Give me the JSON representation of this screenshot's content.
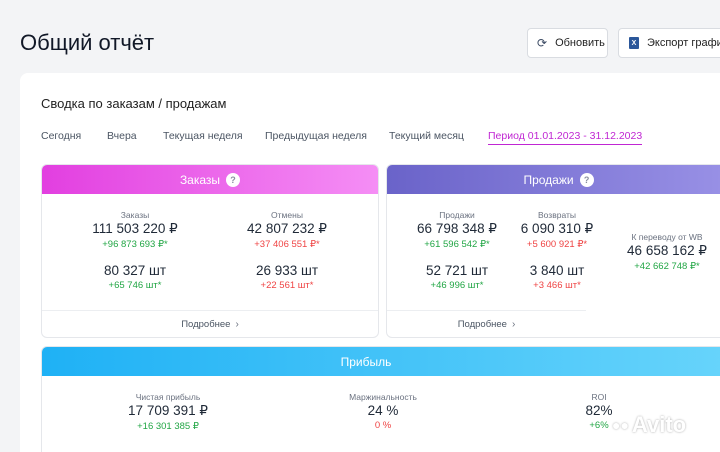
{
  "header": {
    "title": "Общий отчёт",
    "refresh_label": "Обновить",
    "export_label": "Экспорт графика"
  },
  "summary": {
    "title": "Сводка по заказам / продажам",
    "tabs": [
      {
        "label": "Сегодня",
        "active": false
      },
      {
        "label": "Вчера",
        "active": false
      },
      {
        "label": "Текущая неделя",
        "active": false
      },
      {
        "label": "Предыдущая неделя",
        "active": false
      },
      {
        "label": "Текущий месяц",
        "active": false
      },
      {
        "label": "Период 01.01.2023 - 31.12.2023",
        "active": true
      }
    ]
  },
  "orders": {
    "title": "Заказы",
    "help": "?",
    "orders_label": "Заказы",
    "orders_value": "111 503 220 ₽",
    "orders_delta": "+96 873 693 ₽*",
    "cancels_label": "Отмены",
    "cancels_value": "42 807 232 ₽",
    "cancels_delta": "+37 406 551 ₽*",
    "orders_qty": "80 327 шт",
    "orders_qty_delta": "+65 746 шт*",
    "cancels_qty": "26 933 шт",
    "cancels_qty_delta": "+22 561 шт*",
    "more": "Подробнее"
  },
  "sales": {
    "title": "Продажи",
    "help": "?",
    "sales_label": "Продажи",
    "sales_value": "66 798 348 ₽",
    "sales_delta": "+61 596 542 ₽*",
    "returns_label": "Возвраты",
    "returns_value": "6 090 310 ₽",
    "returns_delta": "+5 600 921 ₽*",
    "transfer_label": "К переводу от WB",
    "transfer_value": "46 658 162 ₽",
    "transfer_delta": "+42 662 748 ₽*",
    "sales_qty": "52 721 шт",
    "sales_qty_delta": "+46 996 шт*",
    "returns_qty": "3 840 шт",
    "returns_qty_delta": "+3 466 шт*",
    "more": "Подробнее"
  },
  "profit": {
    "title": "Прибыль",
    "net_label": "Чистая прибыль",
    "net_value": "17 709 391 ₽",
    "net_delta": "+16 301 385 ₽",
    "margin_label": "Маржинальность",
    "margin_value": "24 %",
    "margin_delta": "0 %",
    "roi_label": "ROI",
    "roi_value": "82%",
    "roi_delta": "+6%"
  },
  "watermark": "Avito",
  "colors": {
    "accent": "#c026d3",
    "orders_gradient": [
      "#e23fe0",
      "#f58ef5"
    ],
    "sales_gradient": [
      "#6a63c9",
      "#9991e6"
    ],
    "profit_gradient": [
      "#1fb1f5",
      "#67d4fb"
    ],
    "positive": "#22a645",
    "negative": "#ef4444"
  }
}
